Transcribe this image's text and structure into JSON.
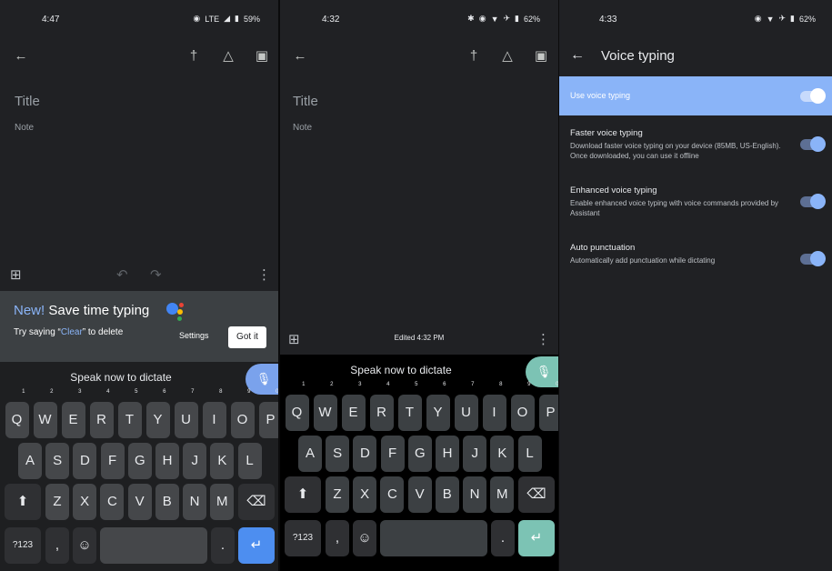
{
  "panel1": {
    "status": {
      "time": "4:47",
      "network": "LTE",
      "battery": "59%"
    },
    "title_placeholder": "Title",
    "note_placeholder": "Note",
    "promo": {
      "new_label": "New!",
      "title": "Save time typing",
      "sub_before": "Try saying “",
      "sub_word": "Clear",
      "sub_after": "” to delete",
      "settings_label": "Settings",
      "gotit_label": "Got it"
    },
    "dictate_text": "Speak now to dictate"
  },
  "panel2": {
    "status": {
      "time": "4:32",
      "battery": "62%"
    },
    "title_placeholder": "Title",
    "note_placeholder": "Note",
    "edited_text": "Edited 4:32 PM",
    "dictate_text": "Speak now to dictate"
  },
  "panel3": {
    "status": {
      "time": "4:33",
      "battery": "62%"
    },
    "header_title": "Voice typing",
    "use_voice_typing": {
      "label": "Use voice typing",
      "enabled": true
    },
    "settings": [
      {
        "title": "Faster voice typing",
        "description": "Download faster voice typing on your device (85MB, US-English). Once downloaded, you can use it offline",
        "enabled": true
      },
      {
        "title": "Enhanced voice typing",
        "description": "Enable enhanced voice typing with voice commands provided by Assistant",
        "enabled": true
      },
      {
        "title": "Auto punctuation",
        "description": "Automatically add punctuation while dictating",
        "enabled": true
      }
    ]
  },
  "keyboard": {
    "row1": [
      "Q",
      "W",
      "E",
      "R",
      "T",
      "Y",
      "U",
      "I",
      "O",
      "P"
    ],
    "row1_hints": [
      "1",
      "2",
      "3",
      "4",
      "5",
      "6",
      "7",
      "8",
      "9",
      "0"
    ],
    "row2": [
      "A",
      "S",
      "D",
      "F",
      "G",
      "H",
      "J",
      "K",
      "L"
    ],
    "row3": [
      "Z",
      "X",
      "C",
      "V",
      "B",
      "N",
      "M"
    ],
    "symbols_label": "?123",
    "comma_label": ",",
    "period_label": ".",
    "shift_glyph": "⬆",
    "backspace_glyph": "⌫",
    "emoji_glyph": "☺",
    "enter_glyph": "↵"
  },
  "colors": {
    "panel_bg": "#202124",
    "accent_blue": "#8ab4f8",
    "enter_blue": "#4d8ef0",
    "enter_teal": "#7cc3b4",
    "promo_bg": "#3c4043"
  },
  "icons": {
    "back": "←",
    "pin": "†",
    "reminder": "△",
    "archive": "▣",
    "add_box": "⊞",
    "undo": "↶",
    "redo": "↷",
    "more": "⋮",
    "mic": "●"
  }
}
